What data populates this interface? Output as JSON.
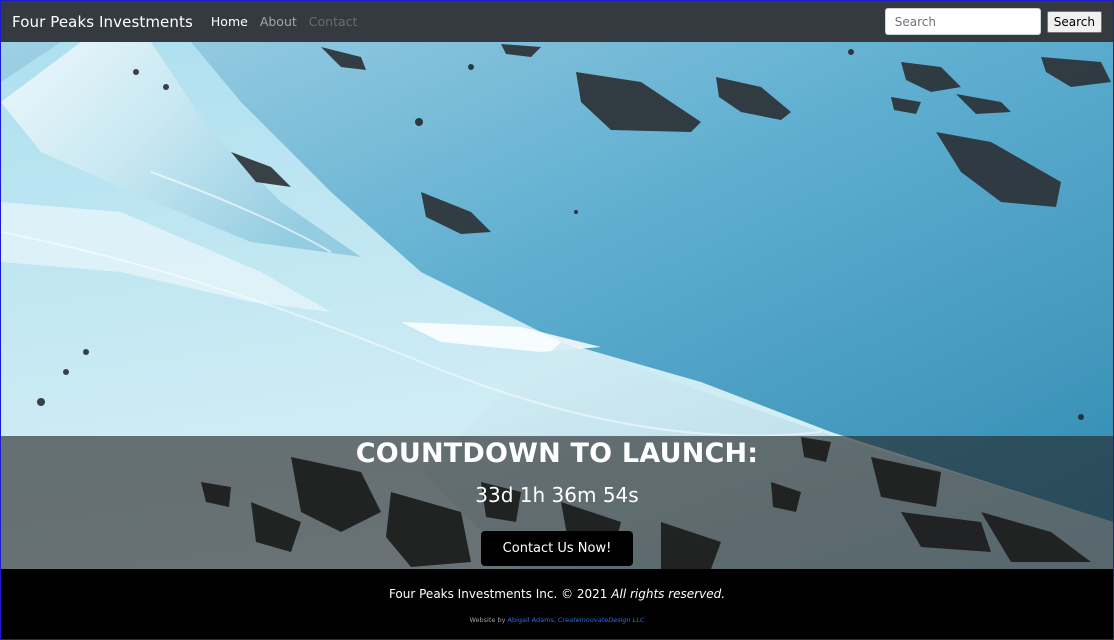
{
  "navbar": {
    "brand": "Four Peaks Investments",
    "links": [
      {
        "label": "Home",
        "state": "active"
      },
      {
        "label": "About",
        "state": "normal"
      },
      {
        "label": "Contact",
        "state": "disabled"
      }
    ],
    "search": {
      "placeholder": "Search",
      "value": "",
      "button_label": "Search"
    }
  },
  "hero": {
    "background_icon": "snowy-mountain-slope-image",
    "headline": "COUNTDOWN TO LAUNCH:",
    "timer": "33d 1h 36m 54s",
    "cta_label": "Contact Us Now!"
  },
  "footer": {
    "copyright_main": "Four Peaks Investments Inc. © 2021",
    "copyright_italic": "All rights reserved.",
    "credit_prefix": "Website by",
    "credit_author": "Abigail Adams,",
    "credit_company": "CreateInnovateDesign LLC"
  },
  "colors": {
    "navbar": "#343a40",
    "cta": "#000000",
    "link": "#2f6fe0",
    "border": "#1b1bd0"
  }
}
